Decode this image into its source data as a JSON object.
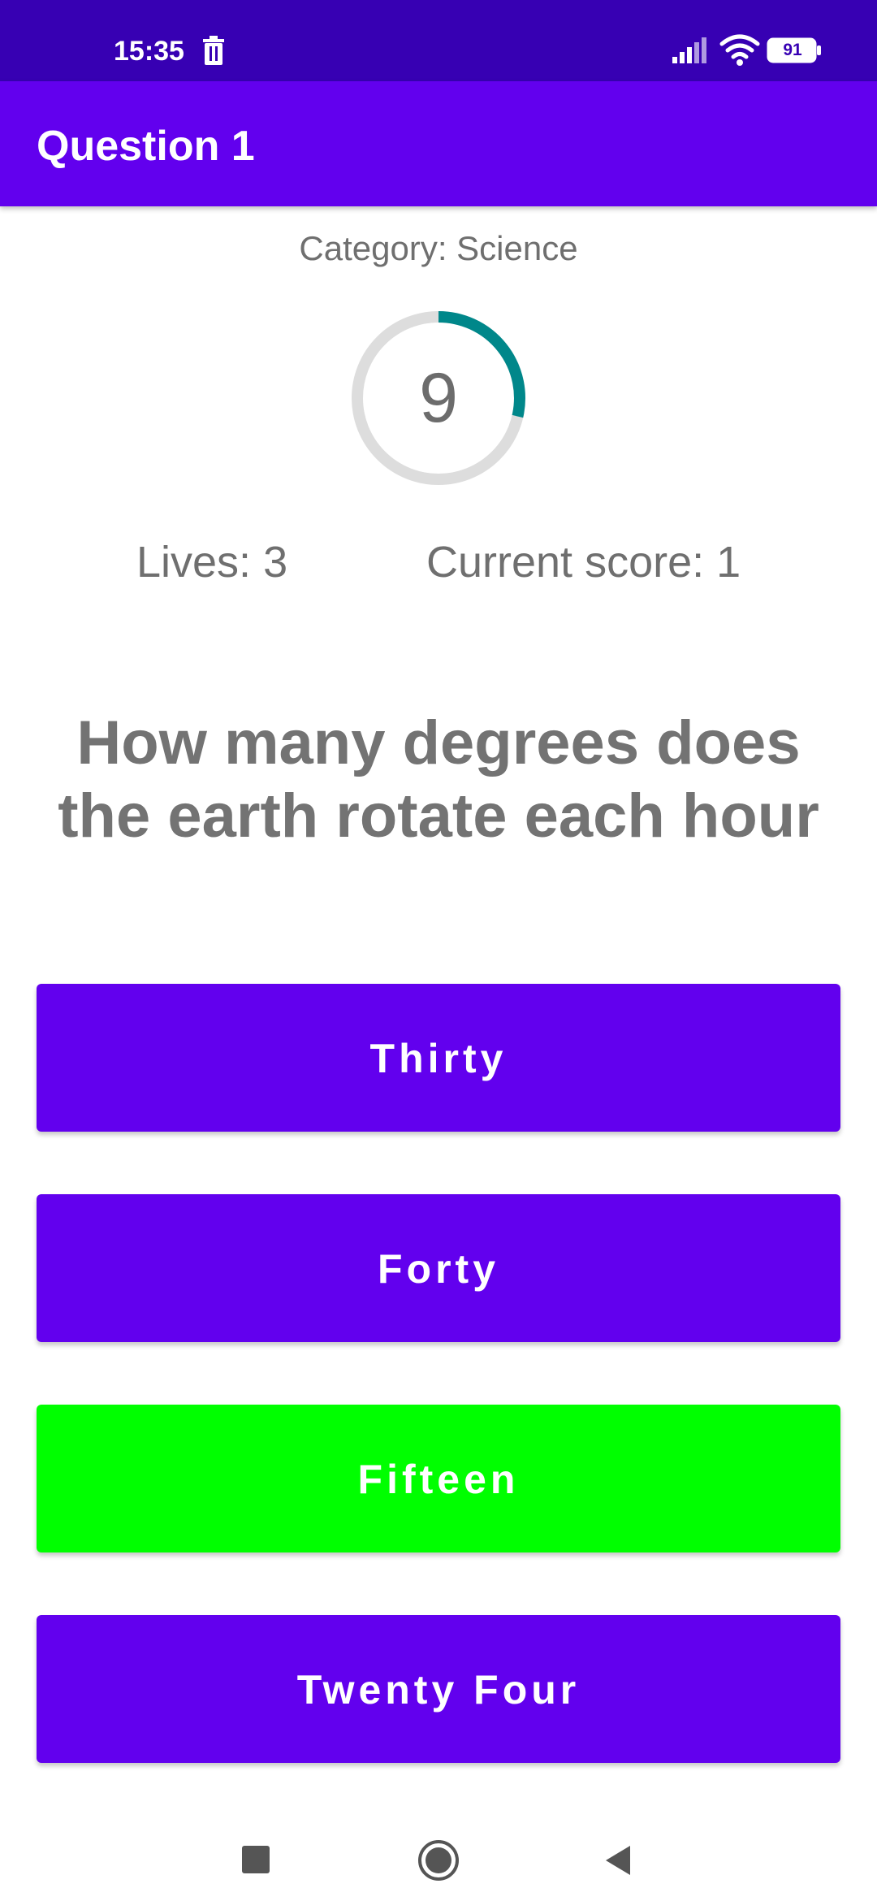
{
  "status_bar": {
    "time": "15:35",
    "battery": "91",
    "icons": [
      "trash-icon",
      "signal-icon",
      "wifi-icon",
      "battery-icon"
    ]
  },
  "app_bar": {
    "title": "Question 1"
  },
  "quiz": {
    "category": "Category: Science",
    "timer_value": "9",
    "lives": "Lives: 3",
    "score": "Current score: 1",
    "question": "How many degrees does the earth rotate each hour"
  },
  "answers": [
    {
      "label": "Thirty",
      "color": "#6200ee"
    },
    {
      "label": "Forty",
      "color": "#6200ee"
    },
    {
      "label": "Fifteen",
      "color": "#00ff00"
    },
    {
      "label": "Twenty Four",
      "color": "#6200ee"
    }
  ],
  "colors": {
    "status_bar": "#3700b3",
    "primary": "#6200ee",
    "correct": "#00ff00",
    "timer_progress": "#00878a",
    "timer_track": "#dddddd"
  },
  "nav_bar": {
    "icons": [
      "recents-icon",
      "home-icon",
      "back-icon"
    ]
  }
}
